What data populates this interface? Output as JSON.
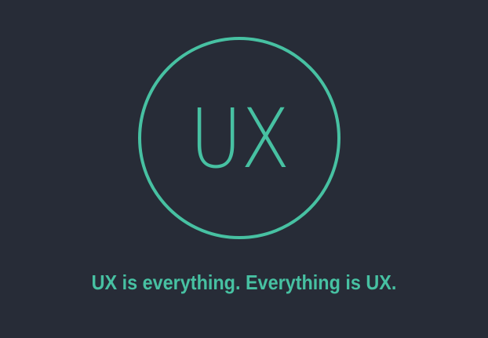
{
  "logo": {
    "text": "UX"
  },
  "tagline": "UX is everything. Everything is UX.",
  "colors": {
    "background": "#272c37",
    "accent": "#47c1a2"
  }
}
